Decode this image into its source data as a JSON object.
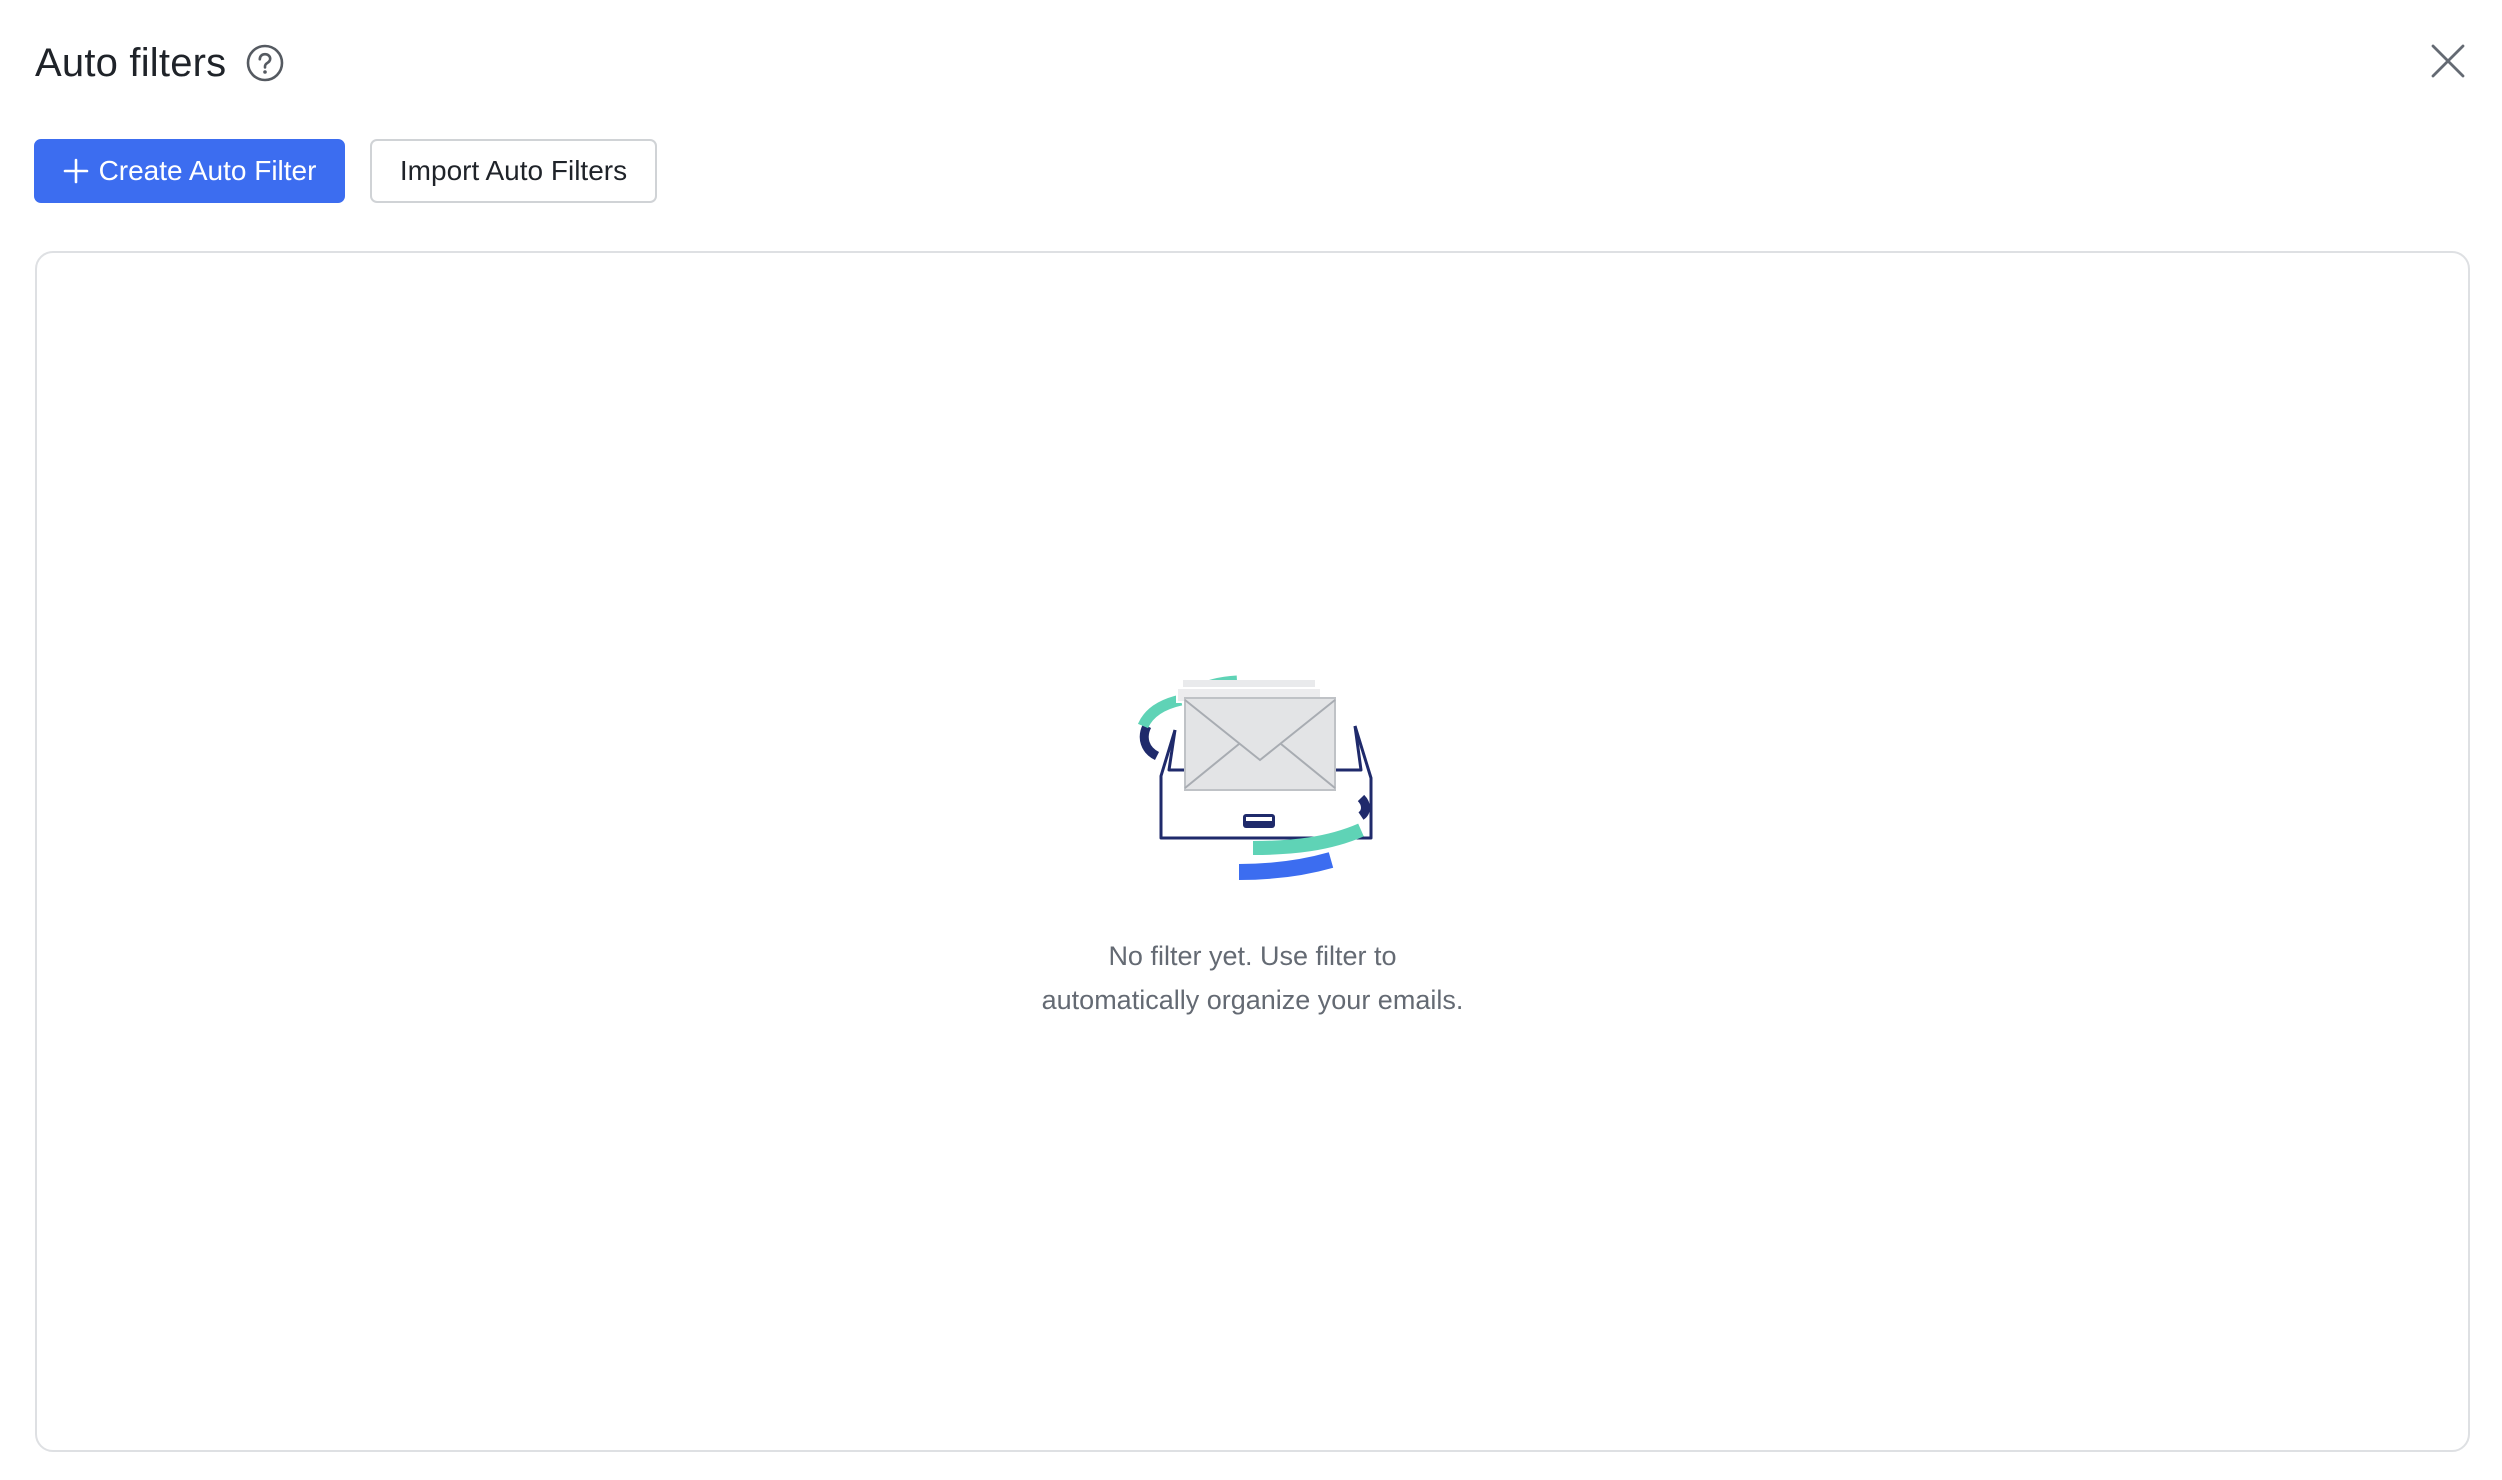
{
  "header": {
    "title": "Auto filters"
  },
  "toolbar": {
    "create_label": "Create Auto Filter",
    "import_label": "Import Auto Filters"
  },
  "empty_state": {
    "line1": "No filter yet. Use filter to",
    "line2": "automatically organize your emails."
  },
  "icons": {
    "help": "question-circle-icon",
    "close": "close-icon",
    "add": "plus-icon",
    "illustration": "inbox-envelope-illustration"
  },
  "colors": {
    "primary": "#3c6df0",
    "teal": "#5fd3b6",
    "navy": "#1f2a6b",
    "envelope": "#e3e4e6",
    "text_muted": "#646a73"
  }
}
